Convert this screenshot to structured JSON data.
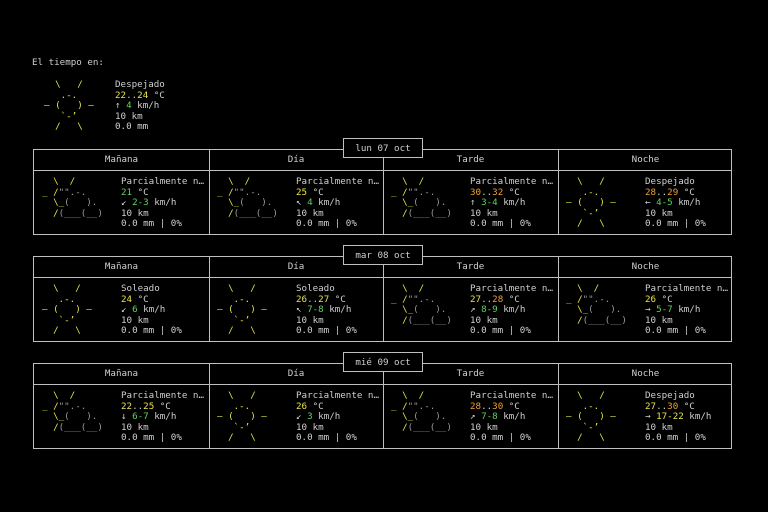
{
  "header": {
    "title": "El tiempo en:"
  },
  "current": {
    "icon": "sun",
    "icon_lines": [
      "   \\   /    ",
      "    .-.     ",
      " ― (   ) ―  ",
      "    `-’     ",
      "   /   \\    "
    ],
    "desc": "Despejado",
    "temp_a": "22",
    "temp_sep": "..",
    "temp_b": "24",
    "temp_unit": " °C",
    "wind_arrow": "↑",
    "wind_val": "4",
    "wind_unit": " km/h",
    "visibility": "10 km",
    "precip": "0.0 mm"
  },
  "columns": [
    "Mañana",
    "Día",
    "Tarde",
    "Noche"
  ],
  "days": [
    {
      "date": "lun 07 oct",
      "periods": [
        {
          "icon": "partly",
          "desc": "Parcialmente n…",
          "temp": "21",
          "temp2": "",
          "temp_class": "green",
          "temp2_class": "",
          "arrow": "↙",
          "wind": "2-3",
          "wind_class": "green",
          "vis": "10 km",
          "precip": "0.0 mm | 0%"
        },
        {
          "icon": "partly",
          "desc": "Parcialmente n…",
          "temp": "25",
          "temp2": "",
          "temp_class": "yellow",
          "temp2_class": "",
          "arrow": "↖",
          "wind": "4",
          "wind_class": "green",
          "vis": "10 km",
          "precip": "0.0 mm | 0%"
        },
        {
          "icon": "partly",
          "desc": "Parcialmente n…",
          "temp": "30",
          "temp2": "32",
          "temp_class": "orange",
          "temp2_class": "orange",
          "arrow": "↑",
          "wind": "3-4",
          "wind_class": "green",
          "vis": "10 km",
          "precip": "0.0 mm | 0%"
        },
        {
          "icon": "sun",
          "desc": "Despejado",
          "temp": "28",
          "temp2": "29",
          "temp_class": "orange",
          "temp2_class": "orange",
          "arrow": "←",
          "wind": "4-5",
          "wind_class": "green",
          "vis": "10 km",
          "precip": "0.0 mm | 0%"
        }
      ]
    },
    {
      "date": "mar 08 oct",
      "periods": [
        {
          "icon": "sun",
          "desc": "Soleado",
          "temp": "24",
          "temp2": "",
          "temp_class": "yellow",
          "temp2_class": "",
          "arrow": "↙",
          "wind": "6",
          "wind_class": "green",
          "vis": "10 km",
          "precip": "0.0 mm | 0%"
        },
        {
          "icon": "sun",
          "desc": "Soleado",
          "temp": "26",
          "temp2": "27",
          "temp_class": "yellow",
          "temp2_class": "yellow",
          "arrow": "↖",
          "wind": "7-8",
          "wind_class": "green",
          "vis": "10 km",
          "precip": "0.0 mm | 0%"
        },
        {
          "icon": "partly",
          "desc": "Parcialmente n…",
          "temp": "27",
          "temp2": "28",
          "temp_class": "yellow",
          "temp2_class": "orange",
          "arrow": "↗",
          "wind": "8-9",
          "wind_class": "green",
          "vis": "10 km",
          "precip": "0.0 mm | 0%"
        },
        {
          "icon": "partly",
          "desc": "Parcialmente n…",
          "temp": "26",
          "temp2": "",
          "temp_class": "yellow",
          "temp2_class": "",
          "arrow": "→",
          "wind": "5-7",
          "wind_class": "green",
          "vis": "10 km",
          "precip": "0.0 mm | 0%"
        }
      ]
    },
    {
      "date": "mié 09 oct",
      "periods": [
        {
          "icon": "partly",
          "desc": "Parcialmente n…",
          "temp": "22",
          "temp2": "25",
          "temp_class": "yellow",
          "temp2_class": "yellow",
          "arrow": "↓",
          "wind": "6-7",
          "wind_class": "green",
          "vis": "10 km",
          "precip": "0.0 mm | 0%"
        },
        {
          "icon": "sun",
          "desc": "Parcialmente n…",
          "temp": "26",
          "temp2": "",
          "temp_class": "yellow",
          "temp2_class": "",
          "arrow": "↙",
          "wind": "3",
          "wind_class": "green",
          "vis": "10 km",
          "precip": "0.0 mm | 0%"
        },
        {
          "icon": "partly",
          "desc": "Parcialmente n…",
          "temp": "28",
          "temp2": "30",
          "temp_class": "orange",
          "temp2_class": "orange",
          "arrow": "↗",
          "wind": "7-8",
          "wind_class": "green",
          "vis": "10 km",
          "precip": "0.0 mm | 0%"
        },
        {
          "icon": "sun",
          "desc": "Despejado",
          "temp": "27",
          "temp2": "30",
          "temp_class": "yellow",
          "temp2_class": "orange",
          "arrow": "→",
          "wind": "17-22",
          "wind_class": "yellow",
          "vis": "10 km",
          "precip": "0.0 mm | 0%"
        }
      ]
    }
  ],
  "icons": {
    "sun": [
      "  \\   /  ",
      "   .-.   ",
      "― (   ) ―",
      "   `-’   ",
      "  /   \\  "
    ],
    "partly": [
      "  \\  /",
      "_ /\"\".-.",
      "  \\_(   ).",
      "  /(___(__)",
      ""
    ]
  },
  "colors": {
    "yellow": "#e8e34a",
    "orange": "#f0a033",
    "green": "#5fd35f",
    "border": "#bfbfbf"
  }
}
